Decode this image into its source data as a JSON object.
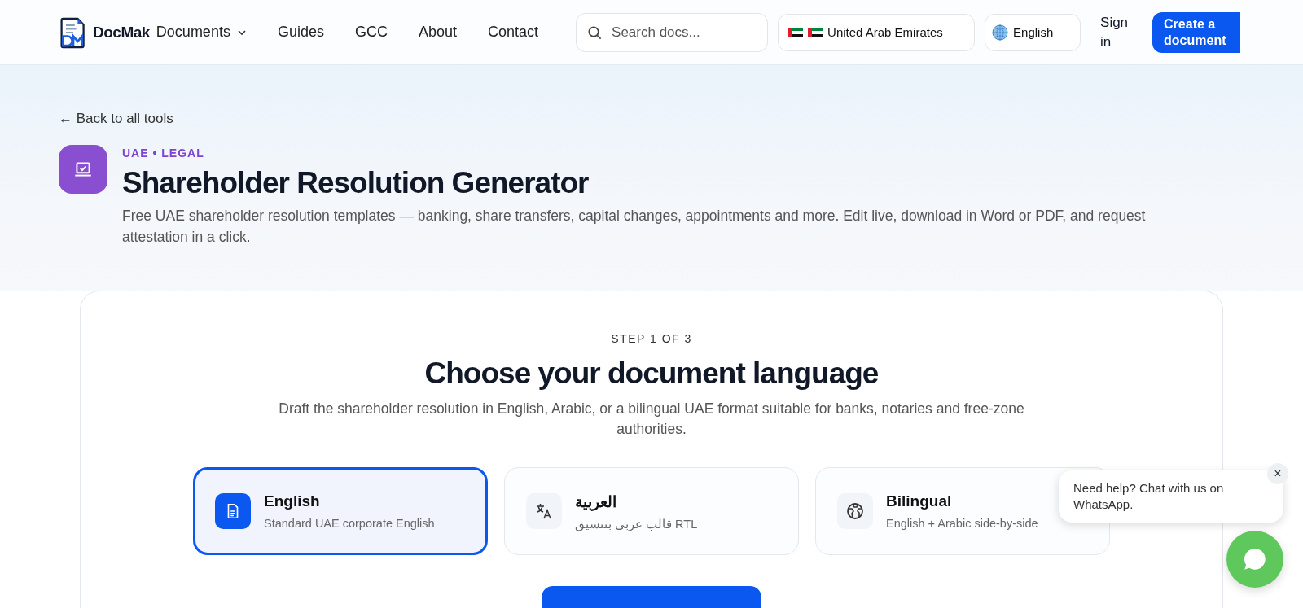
{
  "header": {
    "brand": "DocMak",
    "nav": [
      {
        "label": "Documents",
        "dropdown": true
      },
      {
        "label": "Guides",
        "dropdown": false
      },
      {
        "label": "GCC",
        "dropdown": false
      },
      {
        "label": "About",
        "dropdown": false
      },
      {
        "label": "Contact",
        "dropdown": false
      }
    ],
    "search": {
      "placeholder": "Search docs..."
    },
    "country": "United Arab Emirates",
    "language": "English",
    "sign_in": "Sign in",
    "create_button": "Create a document"
  },
  "hero": {
    "back_link": "← Back to all tools",
    "category": "UAE • LEGAL",
    "title": "Shareholder Resolution Generator",
    "description": "Free UAE shareholder resolution templates — banking, share transfers, capital changes, appointments and more. Edit live, download in Word or PDF, and request attestation in a click."
  },
  "wizard": {
    "step": "STEP 1 OF 3",
    "heading": "Choose your document language",
    "description": "Draft the shareholder resolution in English, Arabic, or a bilingual UAE format suitable for banks, notaries and free-zone authorities.",
    "options": [
      {
        "kind": "document",
        "title": "English",
        "subtitle": "Standard UAE corporate English",
        "selected": true
      },
      {
        "kind": "translate",
        "title": "العربية",
        "subtitle": "قالب عربي بتنسيق RTL",
        "selected": false
      },
      {
        "kind": "globe",
        "title": "Bilingual",
        "subtitle": "English + Arabic side-by-side",
        "selected": false
      }
    ]
  },
  "chat": {
    "message": "Need help? Chat with us on WhatsApp.",
    "close": "×"
  }
}
